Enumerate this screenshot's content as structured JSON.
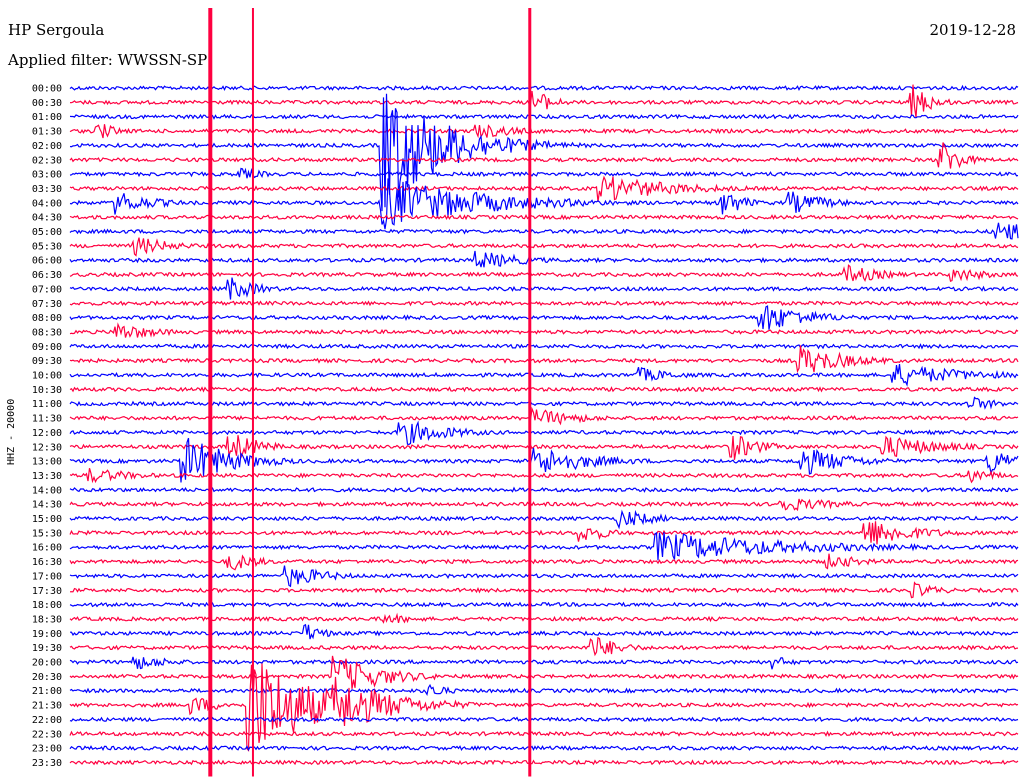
{
  "header": {
    "station": "HP Sergoula",
    "filter": "Applied filter: WWSSN-SP",
    "date": "2019-12-28"
  },
  "chart_data": {
    "type": "line",
    "title": "HP Sergoula",
    "ylabel": "HHZ - 20000",
    "y_categories": [
      "00:00",
      "00:30",
      "01:00",
      "01:30",
      "02:00",
      "02:30",
      "03:00",
      "03:30",
      "04:00",
      "04:30",
      "05:00",
      "05:30",
      "06:00",
      "06:30",
      "07:00",
      "07:30",
      "08:00",
      "08:30",
      "09:00",
      "09:30",
      "10:00",
      "10:30",
      "11:00",
      "11:30",
      "12:00",
      "12:30",
      "13:00",
      "13:30",
      "14:00",
      "14:30",
      "15:00",
      "15:30",
      "16:00",
      "16:30",
      "17:00",
      "17:30",
      "18:00",
      "18:30",
      "19:00",
      "19:30",
      "20:00",
      "20:30",
      "21:00",
      "21:30",
      "22:00",
      "22:30",
      "23:00",
      "23:30"
    ],
    "series_colors": [
      "#0000ff",
      "#ff0040"
    ],
    "color_pattern": "alternating by row, starting with blue at 00:00",
    "events": [
      {
        "row": 1,
        "x": 0.49,
        "amp": 14,
        "dur": 0.02
      },
      {
        "row": 1,
        "x": 0.89,
        "amp": 18,
        "dur": 0.02
      },
      {
        "row": 3,
        "x": 0.43,
        "amp": 8,
        "dur": 0.05
      },
      {
        "row": 3,
        "x": 0.03,
        "amp": 10,
        "dur": 0.02
      },
      {
        "row": 4,
        "x": 0.33,
        "amp": 70,
        "dur": 0.06
      },
      {
        "row": 5,
        "x": 0.92,
        "amp": 20,
        "dur": 0.02
      },
      {
        "row": 6,
        "x": 0.18,
        "amp": 6,
        "dur": 0.03
      },
      {
        "row": 7,
        "x": 0.56,
        "amp": 14,
        "dur": 0.08
      },
      {
        "row": 8,
        "x": 0.05,
        "amp": 12,
        "dur": 0.04
      },
      {
        "row": 8,
        "x": 0.33,
        "amp": 28,
        "dur": 0.1
      },
      {
        "row": 8,
        "x": 0.69,
        "amp": 16,
        "dur": 0.02
      },
      {
        "row": 8,
        "x": 0.76,
        "amp": 12,
        "dur": 0.04
      },
      {
        "row": 10,
        "x": 0.98,
        "amp": 12,
        "dur": 0.04
      },
      {
        "row": 11,
        "x": 0.07,
        "amp": 10,
        "dur": 0.04
      },
      {
        "row": 12,
        "x": 0.43,
        "amp": 10,
        "dur": 0.05
      },
      {
        "row": 13,
        "x": 0.82,
        "amp": 10,
        "dur": 0.04
      },
      {
        "row": 13,
        "x": 0.93,
        "amp": 8,
        "dur": 0.04
      },
      {
        "row": 14,
        "x": 0.17,
        "amp": 12,
        "dur": 0.03
      },
      {
        "row": 16,
        "x": 0.73,
        "amp": 16,
        "dur": 0.05
      },
      {
        "row": 17,
        "x": 0.05,
        "amp": 10,
        "dur": 0.04
      },
      {
        "row": 19,
        "x": 0.77,
        "amp": 16,
        "dur": 0.05
      },
      {
        "row": 20,
        "x": 0.87,
        "amp": 12,
        "dur": 0.08
      },
      {
        "row": 20,
        "x": 0.6,
        "amp": 8,
        "dur": 0.04
      },
      {
        "row": 22,
        "x": 0.95,
        "amp": 8,
        "dur": 0.03
      },
      {
        "row": 23,
        "x": 0.49,
        "amp": 10,
        "dur": 0.05
      },
      {
        "row": 24,
        "x": 0.35,
        "amp": 14,
        "dur": 0.05
      },
      {
        "row": 25,
        "x": 0.17,
        "amp": 16,
        "dur": 0.03
      },
      {
        "row": 25,
        "x": 0.7,
        "amp": 14,
        "dur": 0.03
      },
      {
        "row": 25,
        "x": 0.86,
        "amp": 12,
        "dur": 0.06
      },
      {
        "row": 26,
        "x": 0.12,
        "amp": 26,
        "dur": 0.05
      },
      {
        "row": 26,
        "x": 0.49,
        "amp": 16,
        "dur": 0.06
      },
      {
        "row": 26,
        "x": 0.77,
        "amp": 16,
        "dur": 0.05
      },
      {
        "row": 26,
        "x": 0.97,
        "amp": 14,
        "dur": 0.03
      },
      {
        "row": 27,
        "x": 0.02,
        "amp": 8,
        "dur": 0.05
      },
      {
        "row": 27,
        "x": 0.95,
        "amp": 8,
        "dur": 0.03
      },
      {
        "row": 29,
        "x": 0.75,
        "amp": 8,
        "dur": 0.06
      },
      {
        "row": 30,
        "x": 0.58,
        "amp": 10,
        "dur": 0.04
      },
      {
        "row": 31,
        "x": 0.54,
        "amp": 10,
        "dur": 0.03
      },
      {
        "row": 31,
        "x": 0.84,
        "amp": 16,
        "dur": 0.05
      },
      {
        "row": 32,
        "x": 0.62,
        "amp": 16,
        "dur": 0.14
      },
      {
        "row": 33,
        "x": 0.17,
        "amp": 10,
        "dur": 0.03
      },
      {
        "row": 33,
        "x": 0.8,
        "amp": 8,
        "dur": 0.04
      },
      {
        "row": 34,
        "x": 0.23,
        "amp": 12,
        "dur": 0.04
      },
      {
        "row": 35,
        "x": 0.89,
        "amp": 8,
        "dur": 0.03
      },
      {
        "row": 37,
        "x": 0.33,
        "amp": 6,
        "dur": 0.04
      },
      {
        "row": 38,
        "x": 0.25,
        "amp": 10,
        "dur": 0.02
      },
      {
        "row": 39,
        "x": 0.55,
        "amp": 14,
        "dur": 0.03
      },
      {
        "row": 40,
        "x": 0.07,
        "amp": 8,
        "dur": 0.04
      },
      {
        "row": 40,
        "x": 0.74,
        "amp": 8,
        "dur": 0.02
      },
      {
        "row": 41,
        "x": 0.28,
        "amp": 22,
        "dur": 0.05
      },
      {
        "row": 42,
        "x": 0.38,
        "amp": 8,
        "dur": 0.02
      },
      {
        "row": 43,
        "x": 0.13,
        "amp": 10,
        "dur": 0.03
      },
      {
        "row": 43,
        "x": 0.28,
        "amp": 30,
        "dur": 0.06
      },
      {
        "row": 43,
        "x": 0.19,
        "amp": 60,
        "dur": 0.06
      }
    ],
    "persistent_spikes": [
      {
        "x": 0.148,
        "from_row": 0,
        "to_row": 47,
        "width": 4
      },
      {
        "x": 0.193,
        "from_row": 0,
        "to_row": 47,
        "width": 2
      },
      {
        "x": 0.485,
        "from_row": 0,
        "to_row": 47,
        "width": 3
      }
    ]
  }
}
